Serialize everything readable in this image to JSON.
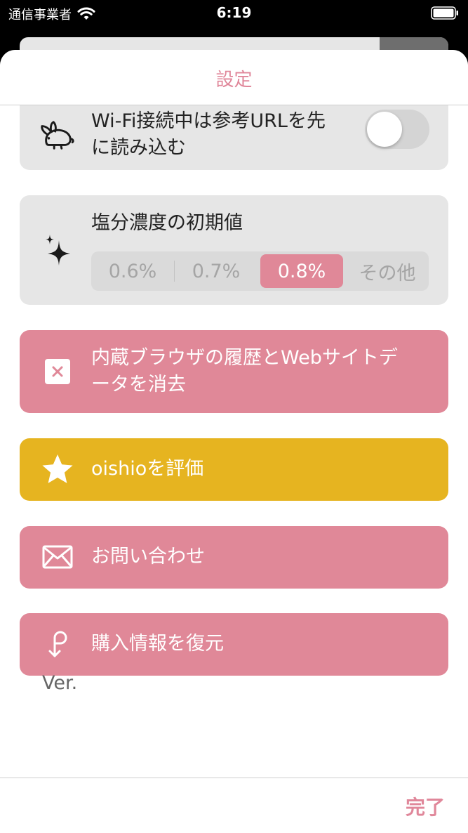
{
  "status_bar": {
    "carrier": "通信事業者",
    "time": "6:19",
    "icons": [
      "wifi-icon",
      "battery-icon"
    ]
  },
  "header": {
    "title": "設定"
  },
  "settings": {
    "wifi_preload": {
      "icon": "rabbit-icon",
      "label_line1": "Wi-Fi接続中は参考URLを先",
      "label_line2": "に読み込む",
      "toggle_on": false
    },
    "salt_default": {
      "icon": "sparkle-icon",
      "label": "塩分濃度の初期値",
      "options": [
        "0.6%",
        "0.7%",
        "0.8%",
        "その他"
      ],
      "selected": "0.8%"
    },
    "clear_history": {
      "icon": "close-box-icon",
      "label_line1": "内蔵ブラウザの履歴とWebサイトデ",
      "label_line2": "ータを消去"
    },
    "rate_app": {
      "icon": "star-icon",
      "label": "oishioを評価"
    },
    "contact": {
      "icon": "envelope-icon",
      "label": "お問い合わせ"
    },
    "restore_purchase": {
      "icon": "restore-arrow-icon",
      "label": "購入情報を復元"
    }
  },
  "version": {
    "label": "Ver."
  },
  "footer": {
    "done_label": "完了"
  },
  "colors": {
    "accent_pink": "#e08898",
    "accent_yellow": "#e6b420",
    "card_gray": "#e6e6e6",
    "title_pink": "#e0879a"
  }
}
